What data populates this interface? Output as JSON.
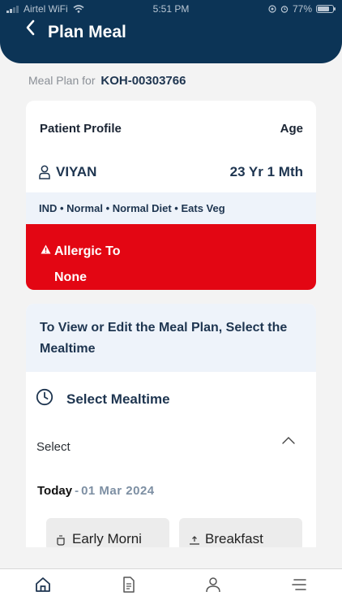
{
  "status_bar": {
    "carrier": "Airtel WiFi",
    "time": "5:51 PM",
    "battery": "77%",
    "battery_level": 0.77
  },
  "header": {
    "title": "Plan Meal",
    "back_icon": "chevron-left-icon"
  },
  "meal_plan_for": {
    "label": "Meal Plan for",
    "patient_id": "KOH-00303766"
  },
  "patient_profile": {
    "heading": "Patient Profile",
    "age_heading": "Age",
    "name": "VIYAN",
    "age": "23 Yr 1 Mth",
    "tags": "IND • Normal • Normal Diet • Eats Veg"
  },
  "allergy": {
    "label": "Allergic To",
    "value": "None",
    "color": "#e30613"
  },
  "mealtime": {
    "instruction": "To View or Edit the Meal Plan, Select the Mealtime",
    "heading": "Select Mealtime",
    "select_label": "Select",
    "today_label": "Today",
    "date": "01 Mar 2024",
    "options": [
      "Early Morni",
      "Breakfast"
    ]
  },
  "bottom_nav": {
    "items": [
      "home-icon",
      "document-icon",
      "profile-icon",
      "menu-icon"
    ]
  },
  "colors": {
    "header": "#0c3456",
    "accent_text": "#1e3550",
    "info_bg": "#eef3fa"
  }
}
